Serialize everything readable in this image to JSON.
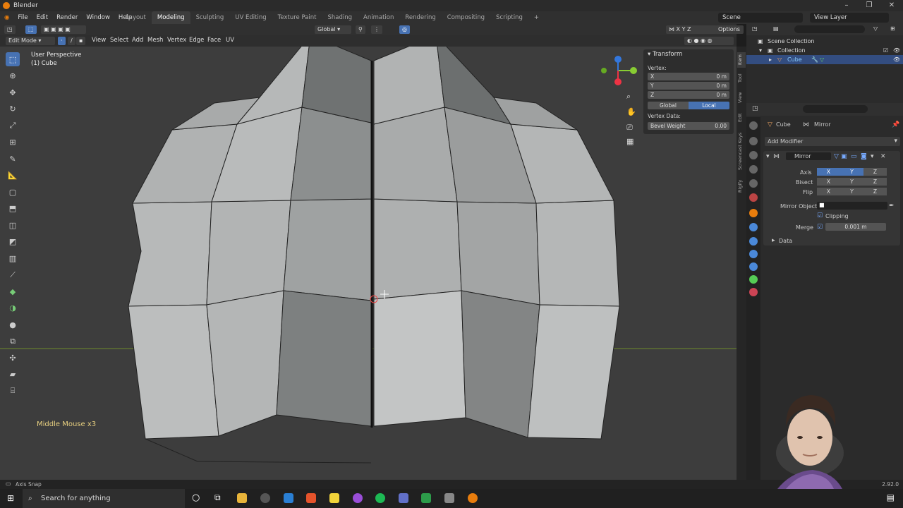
{
  "app": {
    "title": "Blender",
    "version": "2.92.0"
  },
  "menu": [
    "File",
    "Edit",
    "Render",
    "Window",
    "Help"
  ],
  "workspaces": [
    "Layout",
    "Modeling",
    "Sculpting",
    "UV Editing",
    "Texture Paint",
    "Shading",
    "Animation",
    "Rendering",
    "Compositing",
    "Scripting"
  ],
  "active_workspace": "Modeling",
  "scene": "Scene",
  "view_layer": "View Layer",
  "tool_header": {
    "orientation": "Global",
    "options": "Options"
  },
  "view_header": {
    "mode": "Edit Mode",
    "menus": [
      "View",
      "Select",
      "Add",
      "Mesh",
      "Vertex",
      "Edge",
      "Face",
      "UV"
    ]
  },
  "viewport": {
    "perspective": "User Perspective",
    "object": "(1) Cube",
    "key_display": "Middle Mouse x3"
  },
  "npanel": {
    "header": "Transform",
    "vertex_label": "Vertex:",
    "fields": [
      {
        "label": "X",
        "value": "0 m"
      },
      {
        "label": "Y",
        "value": "0 m"
      },
      {
        "label": "Z",
        "value": "0 m"
      }
    ],
    "space_global": "Global",
    "space_local": "Local",
    "vertex_data": "Vertex Data:",
    "bevel_weight_label": "Bevel Weight",
    "bevel_weight_value": "0.00",
    "tabs": [
      "Item",
      "Tool",
      "View",
      "Edit",
      "Screencast Keys",
      "Rigify"
    ]
  },
  "outliner": {
    "root": "Scene Collection",
    "collection": "Collection",
    "object": "Cube"
  },
  "properties": {
    "object": "Cube",
    "modifier_icon_label": "Mirror",
    "add_modifier": "Add Modifier",
    "modifier_name": "Mirror",
    "axis_label": "Axis",
    "bisect_label": "Bisect",
    "flip_label": "Flip",
    "x": "X",
    "y": "Y",
    "z": "Z",
    "mirror_object_label": "Mirror Object",
    "clipping_label": "Clipping",
    "merge_label": "Merge",
    "merge_value": "0.001 m",
    "data_label": "Data"
  },
  "status": {
    "left": "Axis Snap"
  },
  "taskbar": {
    "search_placeholder": "Search for anything"
  },
  "colors": {
    "accent": "#4772b3",
    "selected_row": "#334d80",
    "keys_text": "#e8d080"
  }
}
